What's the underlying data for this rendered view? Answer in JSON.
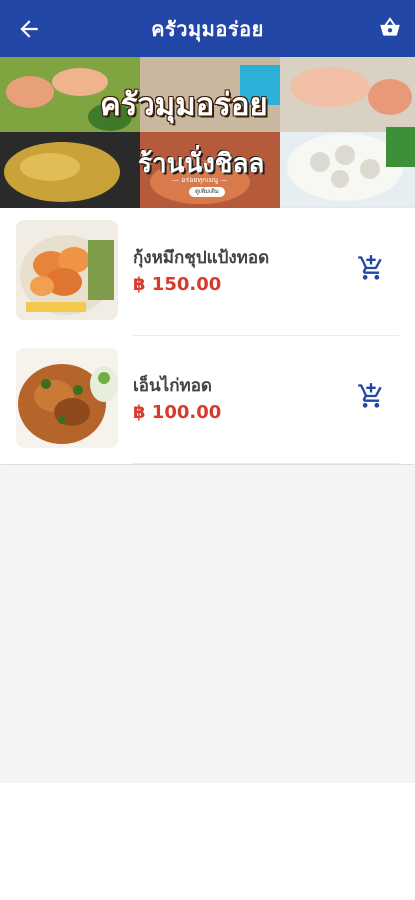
{
  "appbar": {
    "title": "ครัวมุมอร่อย",
    "back_icon": "arrow-left-icon",
    "cart_icon": "shopping-basket-icon",
    "color": "#2347a6"
  },
  "banner": {
    "headline": "ครัวมุมอร่อย",
    "subline": "ร้านนั่งชิลล",
    "tagline": "— อร่อยทุกเมนู —",
    "pill": "ดูเพิ่มเติม"
  },
  "menu_items": [
    {
      "name": "กุ้งหมึกชุปแป้งทอด",
      "price": "฿ 150.00",
      "add_icon": "add-to-cart-icon"
    },
    {
      "name": "เอ็นไก่ทอด",
      "price": "฿ 100.00",
      "add_icon": "add-to-cart-icon"
    }
  ],
  "colors": {
    "accent": "#2347a6",
    "price": "#d83a2c"
  }
}
